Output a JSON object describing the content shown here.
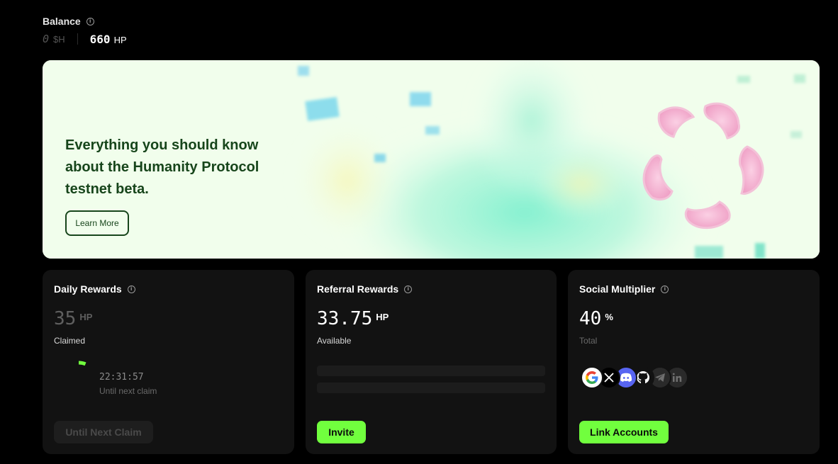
{
  "balance": {
    "title": "Balance",
    "sh_value": "0",
    "sh_unit": "$H",
    "hp_value": "660",
    "hp_unit": "HP"
  },
  "banner": {
    "headline": "Everything you should know about the Humanity Protocol testnet beta.",
    "button_label": "Learn More"
  },
  "daily_rewards": {
    "title": "Daily Rewards",
    "value": "35",
    "unit": "HP",
    "status": "Claimed",
    "countdown": "22:31:57",
    "countdown_label": "Until next claim",
    "button_label": "Until Next Claim",
    "progress_fraction": 0.06
  },
  "referral_rewards": {
    "title": "Referral Rewards",
    "value": "33.75",
    "unit": "HP",
    "status": "Available",
    "button_label": "Invite"
  },
  "social_multiplier": {
    "title": "Social Multiplier",
    "value": "40",
    "unit": "%",
    "status": "Total",
    "button_label": "Link Accounts",
    "accounts": [
      {
        "icon": "google-icon",
        "linked": true
      },
      {
        "icon": "x-icon",
        "linked": true
      },
      {
        "icon": "discord-icon",
        "linked": true
      },
      {
        "icon": "github-icon",
        "linked": true
      },
      {
        "icon": "telegram-icon",
        "linked": false
      },
      {
        "icon": "linkedin-icon",
        "linked": false
      }
    ]
  },
  "colors": {
    "accent": "#71ff3e",
    "banner_text": "#17451b",
    "card_bg": "#121212"
  }
}
